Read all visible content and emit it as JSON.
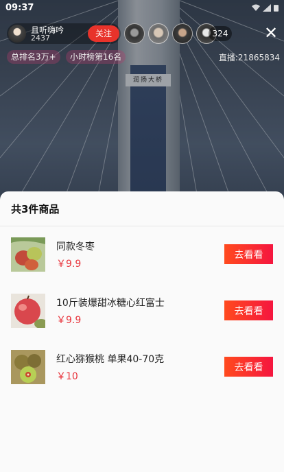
{
  "status_bar": {
    "time": "09:37"
  },
  "anchor": {
    "name": "且听嗨吟",
    "fans": "2437",
    "follow_label": "关注"
  },
  "viewers": {
    "count": "324"
  },
  "rank_tags": [
    "总排名3万+",
    "小时榜第16名"
  ],
  "room": {
    "id_label": "直播:21865834"
  },
  "scene": {
    "plaque_text": "润扬大桥"
  },
  "sheet": {
    "title": "共3件商品",
    "products": [
      {
        "name": "同款冬枣",
        "price": "￥9.9",
        "button": "去看看"
      },
      {
        "name": "10斤装爆甜冰糖心红富士",
        "price": "￥9.9",
        "button": "去看看"
      },
      {
        "name": "红心猕猴桃 单果40-70克",
        "price": "￥10",
        "button": "去看看"
      }
    ]
  },
  "colors": {
    "accent_red": "#e8332b",
    "price_red": "#e8333b",
    "button_gradient_start": "#ff4a1e",
    "button_gradient_end": "#f5163f"
  }
}
